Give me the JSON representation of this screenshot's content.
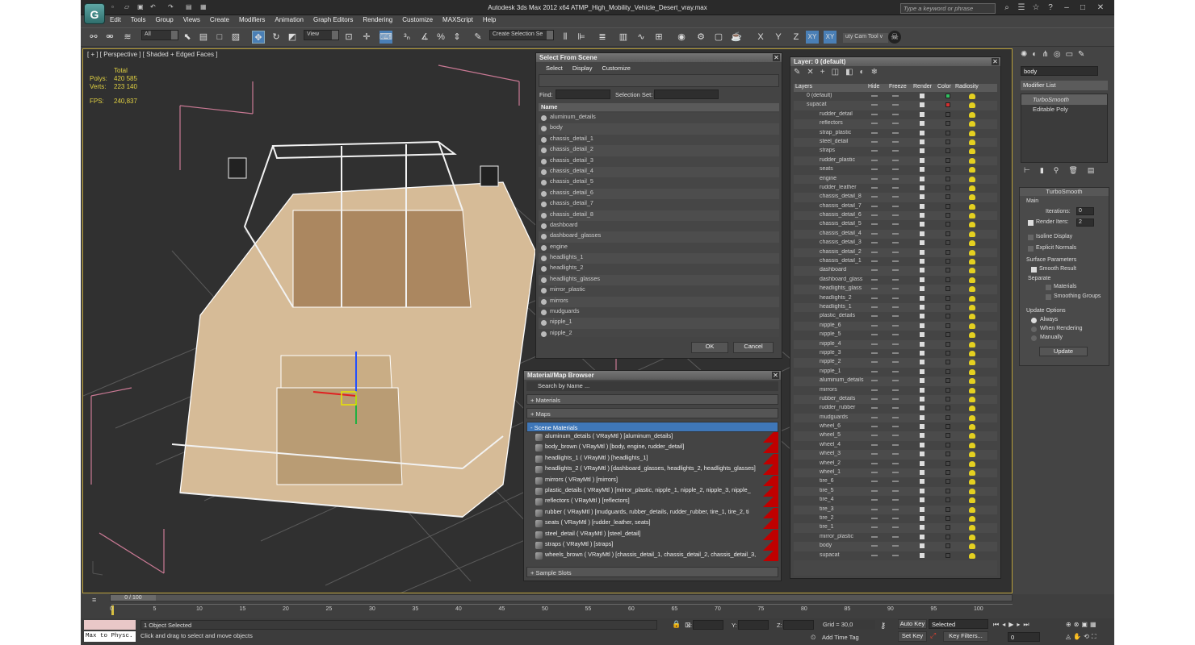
{
  "app": {
    "title": "Autodesk 3ds Max  2012 x64     ATMP_High_Mobility_Vehicle_Desert_vray.max",
    "search_placeholder": "Type a keyword or phrase",
    "logo": "3ds-max-logo"
  },
  "menu": [
    "Edit",
    "Tools",
    "Group",
    "Views",
    "Create",
    "Modifiers",
    "Animation",
    "Graph Editors",
    "Rendering",
    "Customize",
    "MAXScript",
    "Help"
  ],
  "toolbar": {
    "filter": "All",
    "coord": "View",
    "selection_set": "Create Selection Se",
    "camtool": "uty Cam Tool v",
    "axes": [
      "X",
      "Y",
      "Z",
      "XY",
      "XY"
    ]
  },
  "viewport": {
    "label": "[ + ] [ Perspective ] [ Shaded + Edged Faces ]",
    "stats": {
      "total": "Total",
      "polys_label": "Polys:",
      "polys": "420 585",
      "verts_label": "Verts:",
      "verts": "223 140",
      "fps_label": "FPS:",
      "fps": "240,837"
    }
  },
  "select_from_scene": {
    "title": "Select From Scene",
    "menu": [
      "Select",
      "Display",
      "Customize"
    ],
    "find_label": "Find:",
    "selset_label": "Selection Set:",
    "col_name": "Name",
    "items": [
      "aluminum_details",
      "body",
      "chassis_detail_1",
      "chassis_detail_2",
      "chassis_detail_3",
      "chassis_detail_4",
      "chassis_detail_5",
      "chassis_detail_6",
      "chassis_detail_7",
      "chassis_detail_8",
      "dashboard",
      "dashboard_glasses",
      "engine",
      "headlights_1",
      "headlights_2",
      "headlights_glasses",
      "mirror_plastic",
      "mirrors",
      "mudguards",
      "nipple_1",
      "nipple_2"
    ],
    "ok": "OK",
    "cancel": "Cancel"
  },
  "layer_panel": {
    "title": "Layer: 0 (default)",
    "cols": [
      "Layers",
      "Hide",
      "Freeze",
      "Render",
      "Color",
      "Radiosity"
    ],
    "layers": [
      {
        "name": "0 (default)",
        "color": "#30c060",
        "lvl": 0
      },
      {
        "name": "supacat",
        "color": "#d03030",
        "lvl": 0
      }
    ],
    "objects": [
      "rudder_detail",
      "reflectors",
      "strap_plastic",
      "steel_detail",
      "straps",
      "rudder_plastic",
      "seats",
      "engine",
      "rudder_leather",
      "chassis_detail_8",
      "chassis_detail_7",
      "chassis_detail_6",
      "chassis_detail_5",
      "chassis_detail_4",
      "chassis_detail_3",
      "chassis_detail_2",
      "chassis_detail_1",
      "dashboard",
      "dashboard_glass",
      "headlights_glass",
      "headlights_2",
      "headlights_1",
      "plastic_details",
      "nipple_6",
      "nipple_5",
      "nipple_4",
      "nipple_3",
      "nipple_2",
      "nipple_1",
      "aluminum_details",
      "mirrors",
      "rubber_details",
      "rudder_rubber",
      "mudguards",
      "wheel_6",
      "wheel_5",
      "wheel_4",
      "wheel_3",
      "wheel_2",
      "wheel_1",
      "tire_6",
      "tire_5",
      "tire_4",
      "tire_3",
      "tire_2",
      "tire_1",
      "mirror_plastic",
      "body",
      "supacat"
    ]
  },
  "mat_browser": {
    "title": "Material/Map Browser",
    "search": "Search by Name ...",
    "groups": [
      "+ Materials",
      "+ Maps",
      "- Scene Materials",
      "+ Sample Slots"
    ],
    "materials": [
      "aluminum_details  ( VRayMtl ) [aluminum_details]",
      "body_brown  ( VRayMtl ) [body, engine, rudder_detail]",
      "headlights_1  ( VRayMtl ) [headlights_1]",
      "headlights_2  ( VRayMtl ) [dashboard_glasses, headlights_2, headlights_glasses]",
      "mirrors  ( VRayMtl ) [mirrors]",
      "plastic_details  ( VRayMtl ) [mirror_plastic, nipple_1, nipple_2, nipple_3, nipple_",
      "reflectors  ( VRayMtl ) [reflectors]",
      "rubber  ( VRayMtl ) [mudguards, rubber_details, rudder_rubber, tire_1, tire_2, ti",
      "seats  ( VRayMtl ) [rudder_leather, seats]",
      "steel_detail  ( VRayMtl ) [steel_detail]",
      "straps  ( VRayMtl ) [straps]",
      "wheels_brown  ( VRayMtl ) [chassis_detail_1, chassis_detail_2, chassis_detail_3,"
    ]
  },
  "command_panel": {
    "object_name": "body",
    "modifier_list": "Modifier List",
    "stack": [
      "TurboSmooth",
      "Editable Poly"
    ],
    "rollout": "TurboSmooth",
    "main": "Main",
    "iterations_label": "Iterations:",
    "iterations": "0",
    "render_iters_label": "Render Iters:",
    "render_iters": "2",
    "isoline": "Isoline Display",
    "explicit": "Explicit Normals",
    "surface": "Surface Parameters",
    "smooth": "Smooth Result",
    "separate": "Separate",
    "materials": "Materials",
    "smoothing": "Smoothing Groups",
    "update_opts": "Update Options",
    "always": "Always",
    "when_rendering": "When Rendering",
    "manually": "Manually",
    "update": "Update"
  },
  "timeline": {
    "frame": "0 / 100",
    "ticks": [
      "0",
      "5",
      "10",
      "15",
      "20",
      "25",
      "30",
      "35",
      "40",
      "45",
      "50",
      "55",
      "60",
      "65",
      "70",
      "75",
      "80",
      "85",
      "90",
      "95",
      "100"
    ]
  },
  "status": {
    "maxscript": "Max to Physc.",
    "selected": "1 Object Selected",
    "prompt": "Click and drag to select and move objects",
    "x": "X:",
    "y": "Y:",
    "z": "Z:",
    "grid": "Grid = 30,0",
    "add_time_tag": "Add Time Tag",
    "auto_key": "Auto Key",
    "set_key": "Set Key",
    "selected_dd": "Selected",
    "key_filters": "Key Filters...",
    "frame": "0"
  }
}
